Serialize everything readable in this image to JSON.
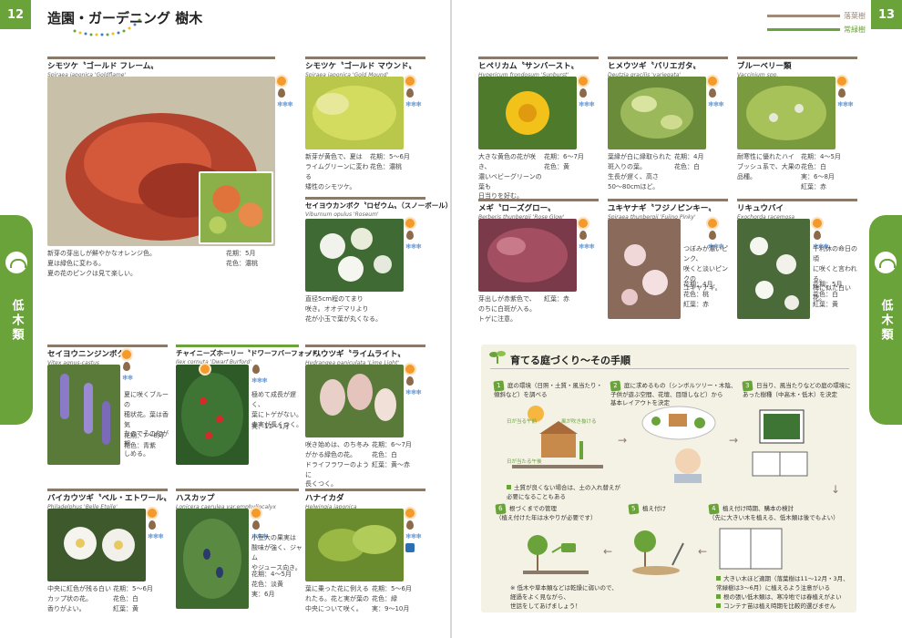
{
  "pages": {
    "left_number": "12",
    "right_number": "13"
  },
  "header": {
    "title": "造園・ガーデニング 樹木"
  },
  "legend": {
    "items": [
      {
        "label": "落葉樹",
        "color": "#a08a78"
      },
      {
        "label": "常緑樹",
        "color": "#6aa339"
      }
    ]
  },
  "side_tab": {
    "label": "低木類"
  },
  "colors": {
    "accent": "#6aa339",
    "rule": "#8a7a6a"
  },
  "plants": [
    {
      "name": "シモツケ〝ゴールド フレーム〟",
      "latin": "Spiraea japonica 'Goldflame'",
      "desc": "新芽の芽出しが鮮やかなオレンジ色。\n夏は緑色に変わる。\n夏の花のピンクは見て楽しい。",
      "spec": "花期：5月\n花色：濃桃"
    },
    {
      "name": "シモツケ〝ゴールド マウンド〟",
      "latin": "Spiraea japonica 'Gold Mound'",
      "desc": "新芽が黄色で、夏は\nライムグリーンに変わる\n矮性のシモツケ。",
      "spec": "花期：5〜6月\n花色：濃桃"
    },
    {
      "name": "セイヨウカンボク〝ロゼウム〟（スノーボール）",
      "latin": "Viburnum opulus 'Roseum'",
      "desc": "直径5cm程のてまり\n咲き。オオデマリより\n花が小玉で葉が丸くなる。",
      "spec": ""
    },
    {
      "name": "ヒペリカム〝サンバースト〟",
      "latin": "Hypericum frondosum 'Sunburst'",
      "desc": "大きな黄色の花が咲き、\n濃いベビーグリーンの葉も\n日当りを好む。",
      "spec": "花期：6〜7月\n花色：黄"
    },
    {
      "name": "ヒメウツギ〝バリエガタ〟",
      "latin": "Deutzia gracilis 'variegata'",
      "desc": "葉縁が白に縁取られた斑入りの葉。\n生長が遅く、高さ\n50〜80cmほど。",
      "spec": "花期：4月\n花色：白"
    },
    {
      "name": "ブルーベリー類",
      "latin": "Vaccinium spp.",
      "desc": "耐寒性に優れたハイ\nブッシュ系で、大果の\n品種。",
      "spec": "花期：4〜5月\n花色：白\n実：6〜8月\n紅葉：赤"
    },
    {
      "name": "メギ〝ローズグロー〟",
      "latin": "Berberis thunbergii 'Rose Glow'",
      "desc": "芽出しが赤紫色で、\nのちに白斑が入る。\nトゲに注意。",
      "spec": "紅葉：赤"
    },
    {
      "name": "ユキヤナギ〝フジノピンキー〟",
      "latin": "Spiraea thunbergii 'Fujino Pinky'",
      "desc": "つぼみが濃いピンク、\n咲くと淡いピンクの\nユキヤナギ。",
      "spec": "花期：4月\n花色：桃\n紅葉：赤"
    },
    {
      "name": "リキュウバイ",
      "latin": "Exochorda racemosa",
      "desc": "千利休の命日の頃\nに咲くと言われる。\n梅に似た白い花。",
      "spec": "花期：5月\n花色：白\n紅葉：黄"
    },
    {
      "name": "セイヨウニンジンボク",
      "latin": "Vitex agnus-castus",
      "desc": "夏に咲くブルーの\n穂状花。葉は香気\nなのでその匂が期\nしめる。",
      "spec": "花期：7〜8月\n花色：青紫"
    },
    {
      "name": "チャイニーズホーリー〝ドワーフバーフォード〟",
      "latin": "Ilex cornuta 'Dwarf Burford'",
      "desc": "極めて成長が遅く、\n葉にトゲがない。\n赤実が長くつく。",
      "spec": "実：11〜1月"
    },
    {
      "name": "ノリウツギ〝ライムライト〟",
      "latin": "Hydrangea paniculata 'Lime Light'",
      "desc": "咲き始めは、のち冬み\nがかる緑色の花。\nドライフラワーのように\n長くつく。",
      "spec": "花期：6〜7月\n花色：白\n紅葉：黄〜赤"
    },
    {
      "name": "バイカウツギ〝ベル・エトワール〟",
      "latin": "Philadelphus 'Belle Etoile'",
      "desc": "中央に紅色が残る白い\nカップ状の花。\n香りがよい。",
      "spec": "花期：5〜6月\n花色：白\n紅葉：黄"
    },
    {
      "name": "ハスカップ",
      "latin": "Lonicera caerulea var.emphyllocalyx",
      "desc": "小豆大の果実は\n酸味が強く、ジャム\nやジュース向き。",
      "spec": "花期：4〜5月\n花色：淡黄\n実：6月"
    },
    {
      "name": "ハナイカダ",
      "latin": "Helwingia japonica",
      "desc": "葉に乗った花に例える\nれたる。花と実が葉の\n中央について咲く。",
      "spec": "花期：5〜6月\n花色：緑\n実：9〜10月"
    }
  ],
  "steps": {
    "title": "育てる庭づくり〜その手順",
    "items": [
      {
        "num": "1",
        "text": "庭の環境（日照・土質・風当たり・\n傾斜など）を調べる"
      },
      {
        "num": "2",
        "text": "庭に求めるもの（シンボルツリー・木陰、\n子供が遊ぶ空間、花壇、目隠しなど）から\n基本レイアウトを決定"
      },
      {
        "num": "3",
        "text": "日当り、風当たりなどの庭の環境に\nあった樹種（中高木・低木）を決定"
      },
      {
        "num": "4",
        "text": "植え付け時期、購本の検討\n（先に大きい木を植える、低木類は後でもよい）"
      },
      {
        "num": "5",
        "text": "植え付け"
      },
      {
        "num": "6",
        "text": "根づくまでの管理\n（植え付けた年は水やりが必要です）"
      }
    ],
    "labels": {
      "sun_morning": "日が当る午前",
      "wind": "風が吹き抜ける",
      "sun_afternoon": "日が当たる午後"
    },
    "notes": [
      "土質が良くない場合は、土の入れ替えが\n必要になることもある",
      "大きい木ほど適期（落葉樹は11〜12月・3月、\n常緑樹は3〜6月）に植えるよう注意がいる",
      "根の張い低木類は、寒冷地では春植えがよい",
      "コンテナ苗は植え時期を比較的選びません"
    ],
    "care_note": "※ 低木や草本類などは乾燥に弱いので、\n経過をよく見ながら、\n世話をしてあげましょう！"
  }
}
